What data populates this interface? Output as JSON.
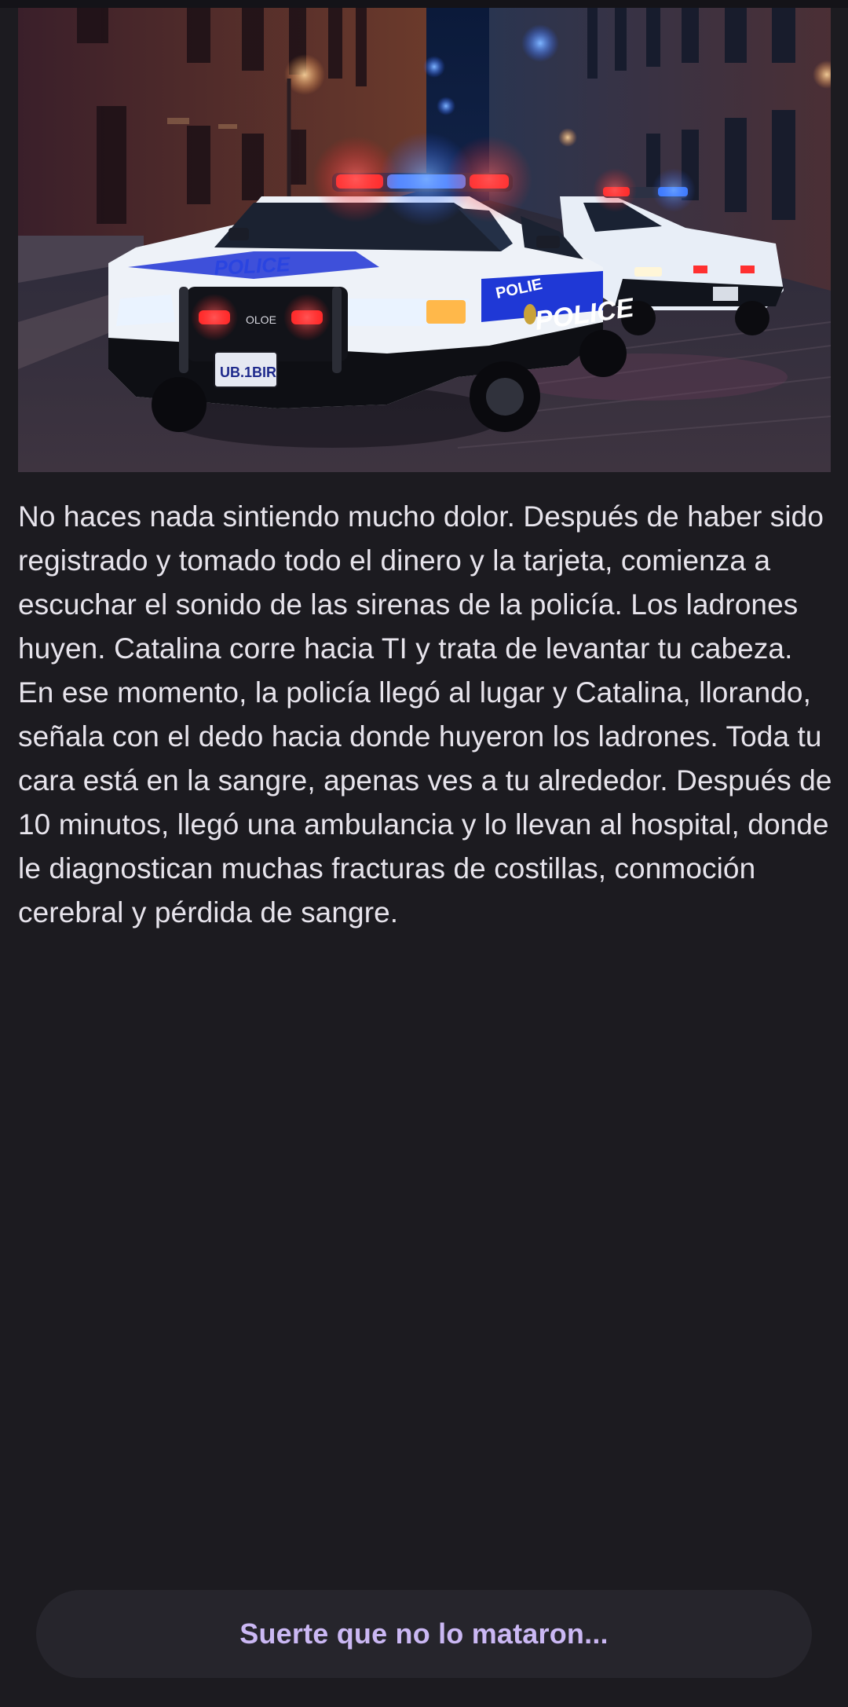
{
  "story": {
    "image": {
      "car_text_hood": "POLICE",
      "car_text_door": "POLICE",
      "car_text_fender": "POLIE",
      "plate_text": "UB.1BIR",
      "grille_text": "OLOE"
    },
    "text": "No haces nada sintiendo mucho dolor. Después de haber sido registrado y tomado todo el dinero y la tarjeta, comienza a escuchar el sonido de las sirenas de la policía. Los ladrones huyen. Catalina corre hacia TI y trata de levantar tu cabeza. En ese momento, la policía llegó al lugar y Catalina, llorando, señala con el dedo hacia donde huyeron los ladrones. Toda tu cara está en la sangre, apenas ves a tu alrededor. Después de 10 minutos, llegó una ambulancia y lo llevan al hospital, donde le diagnostican muchas fracturas de costillas, conmoción cerebral y pérdida de sangre."
  },
  "choice": {
    "label": "Suerte que no lo mataron..."
  },
  "colors": {
    "background": "#1c1b20",
    "text": "#e7e4ec",
    "button_bg": "#26252c",
    "button_text": "#cbb8f4"
  }
}
